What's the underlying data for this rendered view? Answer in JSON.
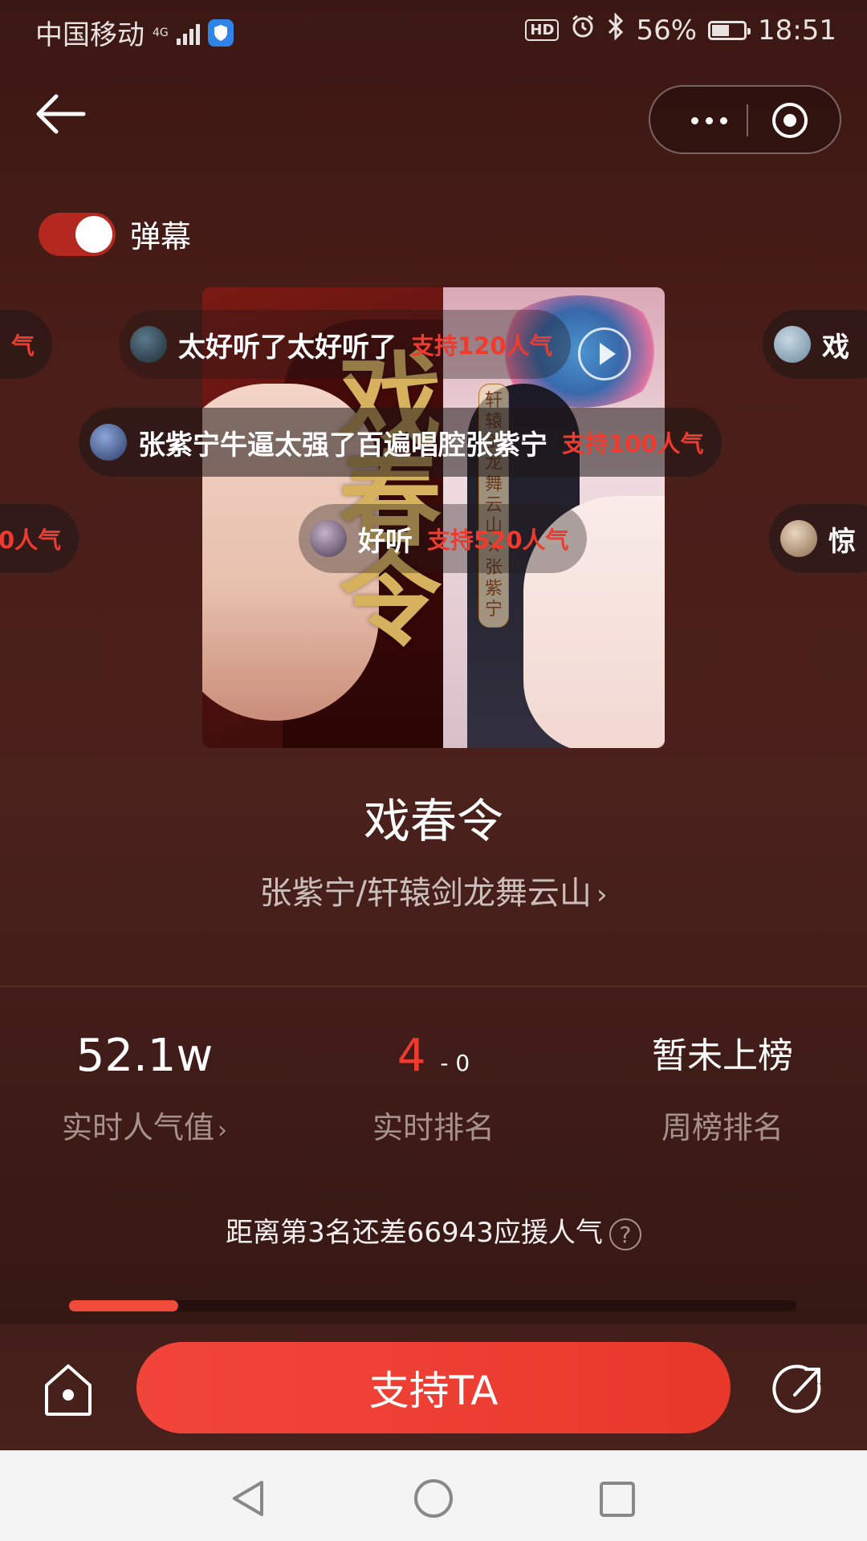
{
  "status_bar": {
    "carrier": "中国移动",
    "network": "4G",
    "battery_percent": "56%",
    "battery_level": 0.56,
    "time": "18:51",
    "hd_label": "HD",
    "icons": [
      "signal-icon",
      "shield-icon",
      "hd-icon",
      "alarm-icon",
      "bluetooth-icon",
      "battery-icon"
    ]
  },
  "nav": {
    "back_icon": "back-arrow-icon",
    "more_icon": "more-dots-icon",
    "close_icon": "target-close-icon"
  },
  "danmaku": {
    "toggle_label": "弹幕",
    "enabled": true,
    "messages": [
      {
        "text": "气",
        "support": ""
      },
      {
        "text": "太好听了太好听了",
        "support": "支持120人气"
      },
      {
        "text": "戏",
        "support": ""
      },
      {
        "text": "张紫宁牛逼太强了百遍唱腔张紫宁",
        "support": "支持100人气"
      },
      {
        "text": "",
        "support": "0人气"
      },
      {
        "text": "好听",
        "support": "支持520人气"
      },
      {
        "text": "惊",
        "support": ""
      }
    ]
  },
  "album": {
    "art_text": "戏春令",
    "art_subtitle": "轩辕剑龙舞云山×张紫宁",
    "play_icon": "play-circle-icon"
  },
  "song": {
    "title": "戏春令",
    "artist": "张紫宁/轩辕剑龙舞云山",
    "artist_chevron": "›"
  },
  "stats": {
    "popularity_value": "52.1w",
    "popularity_label": "实时人气值",
    "rank_value": "4",
    "rank_change": "- 0",
    "rank_label": "实时排名",
    "weekly_value": "暂未上榜",
    "weekly_label": "周榜排名",
    "chevron": "›"
  },
  "gap": {
    "text": "距离第3名还差66943应援人气",
    "help_icon_label": "?"
  },
  "progress": {
    "fraction": 0.15
  },
  "actions": {
    "support_label": "支持TA",
    "home_icon": "home-icon",
    "share_icon": "share-icon"
  },
  "system_nav": {
    "icons": [
      "nav-back-icon",
      "nav-home-icon",
      "nav-recent-icon"
    ]
  },
  "colors": {
    "accent": "#ee3b30",
    "background": "#4a1d18",
    "toggle_on": "#b3291f"
  }
}
